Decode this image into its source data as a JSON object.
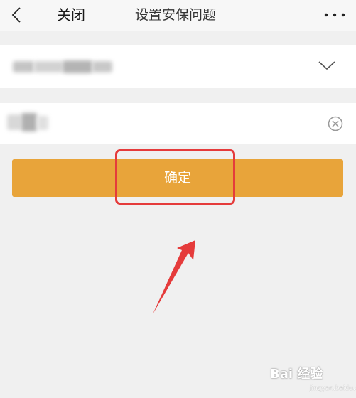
{
  "navbar": {
    "back_icon": "chevron-left-icon",
    "close_label": "关闭",
    "title": "设置安保问题",
    "more_icon": "more-horizontal-icon"
  },
  "form": {
    "question_field": {
      "dropdown_icon": "chevron-down-icon"
    },
    "answer_field": {
      "clear_icon": "clear-circle-icon"
    }
  },
  "confirm_button": {
    "label": "确定",
    "color": "#e8a43a"
  },
  "annotation": {
    "highlight_color": "#e53b3b",
    "arrow_color": "#e53b3b"
  },
  "watermark": {
    "text": "Bai 经验",
    "sub": "jingyan.baidu.com"
  }
}
